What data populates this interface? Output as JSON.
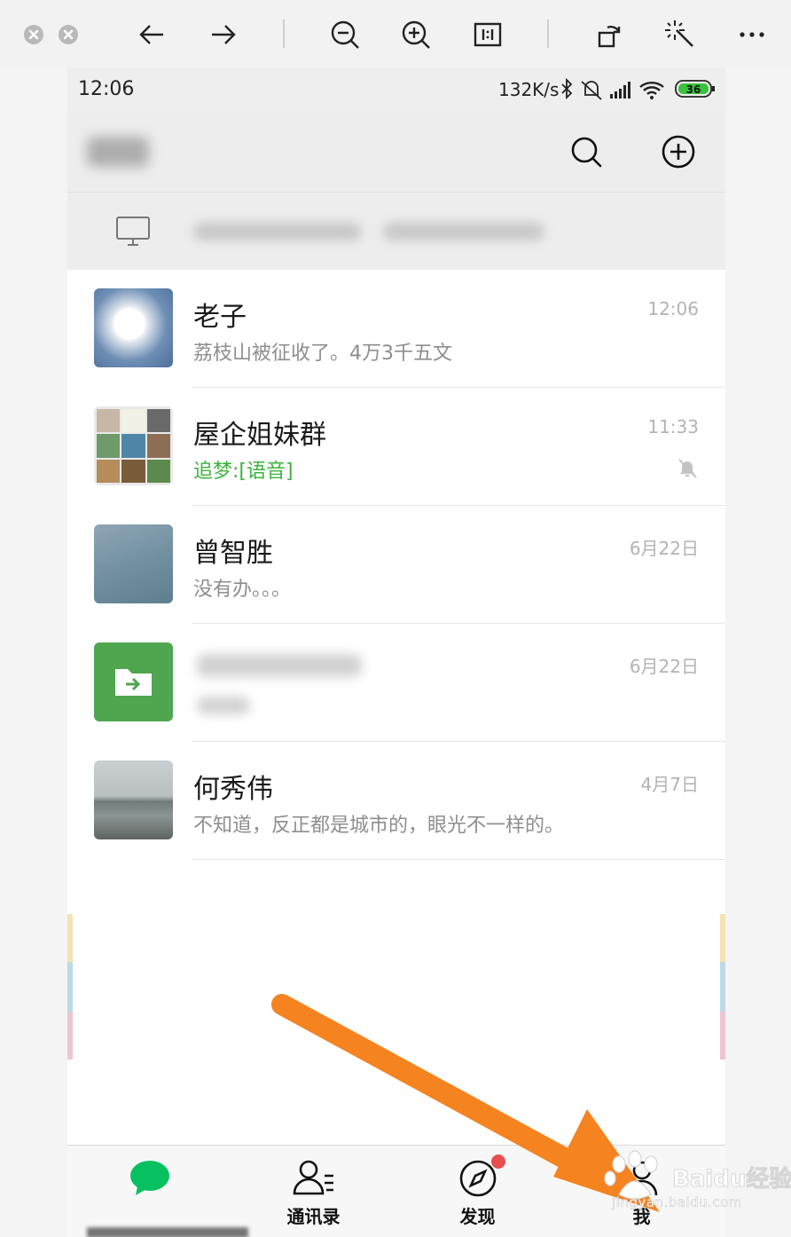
{
  "status_bar": {
    "time": "12:06",
    "net_speed": "132K/s",
    "battery": "36"
  },
  "chats": [
    {
      "name": "老子",
      "message": "荔枝山被征收了。4万3千五文",
      "time": "12:06",
      "message_color": "gray"
    },
    {
      "name": "屋企姐妹群",
      "message": "追梦:[语音]",
      "time": "11:33",
      "message_color": "green",
      "muted": true
    },
    {
      "name": "曾智胜",
      "message": "没有办。。。",
      "time": "6月22日",
      "message_color": "gray"
    },
    {
      "name": "",
      "message": "",
      "time": "6月22日",
      "message_color": "gray",
      "blurred": true
    },
    {
      "name": "何秀伟",
      "message": "不知道，反正都是城市的，眼光不一样的。",
      "time": "4月7日",
      "message_color": "gray"
    }
  ],
  "tabs": [
    {
      "label": "",
      "icon": "chat-bubble-icon",
      "active": true
    },
    {
      "label": "通讯录",
      "icon": "contacts-icon"
    },
    {
      "label": "发现",
      "icon": "compass-icon",
      "badge": true
    },
    {
      "label": "我",
      "icon": "person-icon"
    }
  ],
  "watermark": {
    "text": "Baidu经验",
    "url": "jingyan.baidu.com"
  },
  "colors": {
    "accent_green": "#07c160",
    "annotation_arrow": "#f5831f",
    "badge_red": "#e84e4e"
  }
}
